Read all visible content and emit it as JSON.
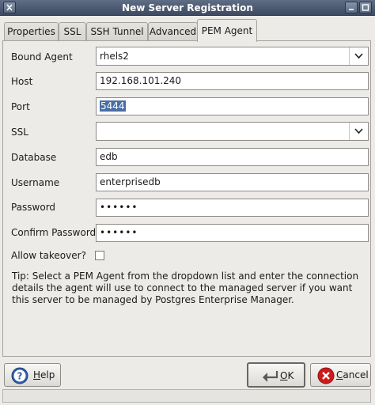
{
  "window": {
    "title": "New Server Registration"
  },
  "tabs": [
    {
      "label": "Properties"
    },
    {
      "label": "SSL"
    },
    {
      "label": "SSH Tunnel"
    },
    {
      "label": "Advanced"
    },
    {
      "label": "PEM Agent",
      "active": true
    }
  ],
  "form": {
    "bound_agent": {
      "label": "Bound Agent",
      "value": "rhels2"
    },
    "host": {
      "label": "Host",
      "value": "192.168.101.240"
    },
    "port": {
      "label": "Port",
      "value": "5444"
    },
    "ssl": {
      "label": "SSL",
      "value": ""
    },
    "database": {
      "label": "Database",
      "value": "edb"
    },
    "username": {
      "label": "Username",
      "value": "enterprisedb"
    },
    "password": {
      "label": "Password",
      "value": "••••••"
    },
    "confirm_password": {
      "label": "Confirm Password",
      "value": "••••••"
    },
    "allow_takeover": {
      "label": "Allow takeover?",
      "checked": false
    }
  },
  "tip": "Tip: Select a PEM Agent from the dropdown list and enter the connection details the agent will use to connect to the managed server if you want this server to be managed by Postgres Enterprise Manager.",
  "buttons": {
    "help": {
      "label": "Help",
      "mnemonic": "H",
      "rest": "elp"
    },
    "ok": {
      "label": "OK",
      "mnemonic": "O",
      "rest": "K"
    },
    "cancel": {
      "label": "Cancel",
      "mnemonic": "C",
      "rest": "ancel"
    }
  },
  "icons": {
    "help": "help-icon",
    "ok": "ok-icon",
    "cancel": "cancel-icon",
    "dropdown": "chevron-down-icon"
  },
  "colors": {
    "titlebar": "#4a5870",
    "selection": "#4a6fa5",
    "cancel_red": "#cc1b1b",
    "help_blue": "#2f5fa8"
  }
}
